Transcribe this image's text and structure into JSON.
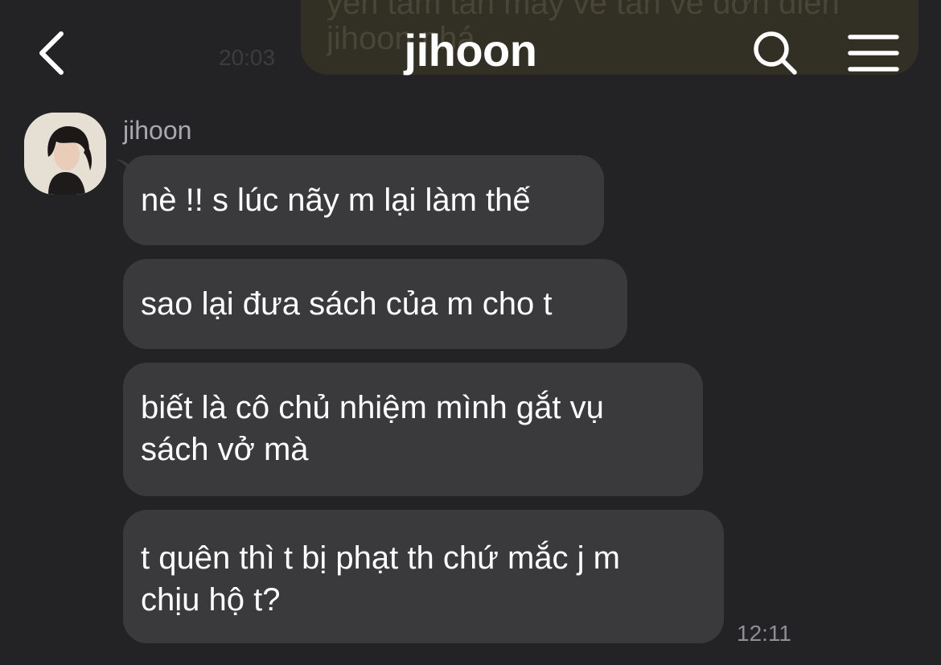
{
  "header": {
    "title": "jihoon",
    "back_icon": "chevron-left-icon",
    "search_icon": "search-icon",
    "menu_icon": "hamburger-menu-icon"
  },
  "previous_message": {
    "line1": "yên tâm tan máy về tan về đơn điền",
    "line2": "jihoon nhá",
    "time": "20:03"
  },
  "chat": {
    "sender_name": "jihoon",
    "messages": [
      {
        "lines": [
          "nè !! s lúc nãy m lại làm thế"
        ]
      },
      {
        "lines": [
          "sao lại đưa sách của m cho t"
        ]
      },
      {
        "lines": [
          "biết là cô chủ nhiệm mình gắt vụ",
          "sách vở mà"
        ]
      },
      {
        "lines": [
          "t quên thì t bị phạt th chứ mắc j m",
          "chịu hộ t?"
        ]
      }
    ],
    "last_timestamp": "12:11"
  },
  "colors": {
    "background": "#232325",
    "bubble_incoming": "#3a3a3d",
    "bubble_outgoing_faded": "#322f24",
    "text_primary": "#ffffff",
    "text_secondary": "#a9a9ad"
  }
}
